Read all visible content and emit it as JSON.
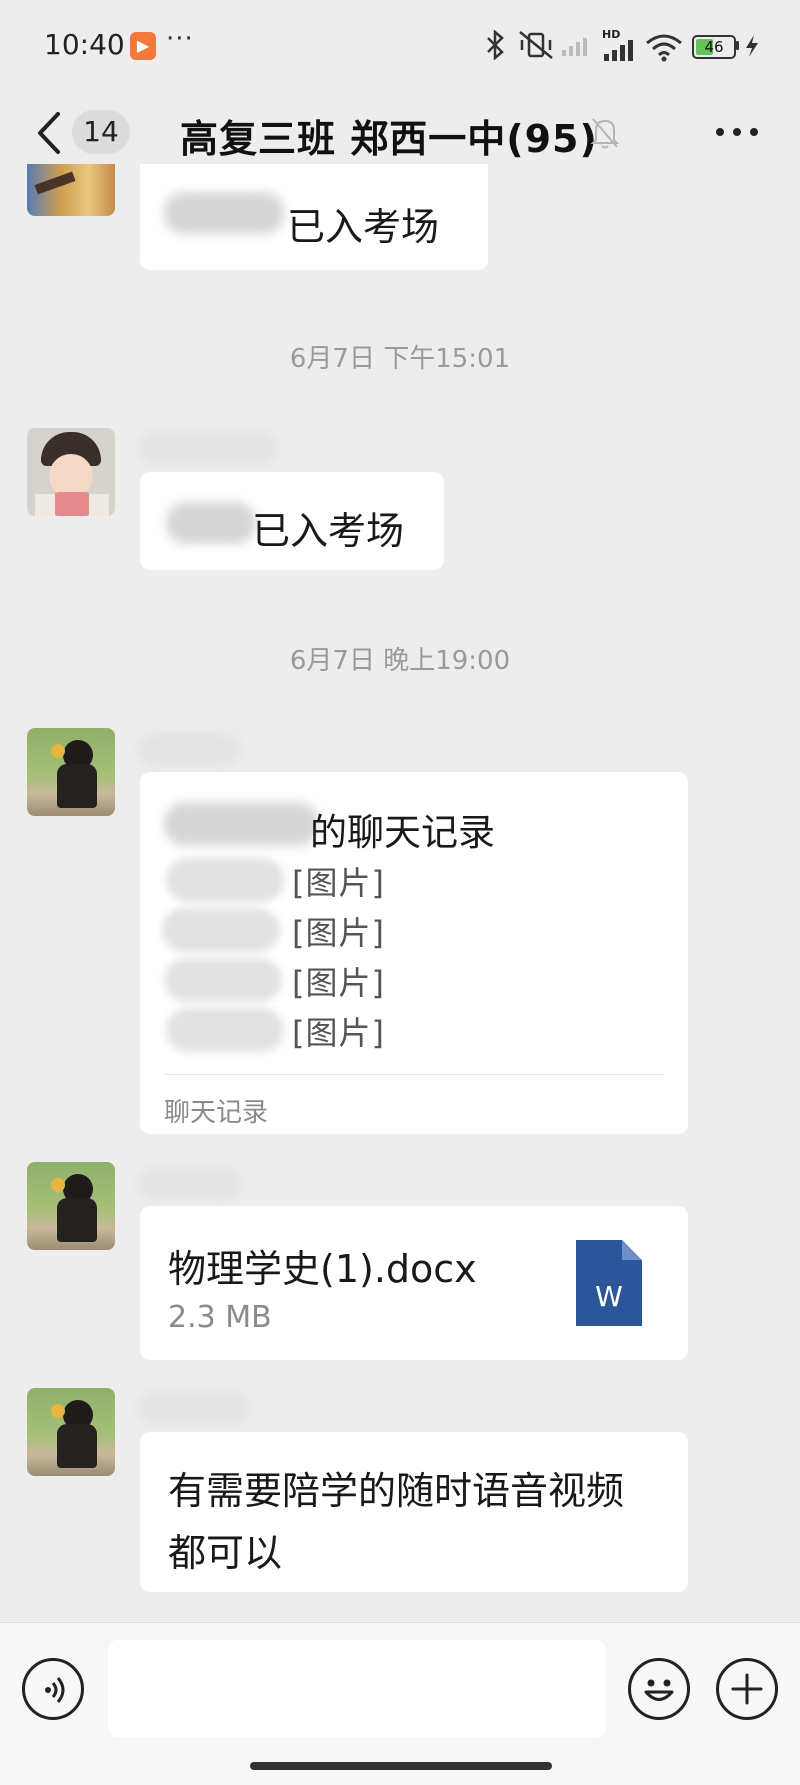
{
  "status_bar": {
    "time": "10:40",
    "more": "···",
    "network": "HD",
    "battery": "46",
    "battery_level": 0.46,
    "app_icon_name": "video-app-icon"
  },
  "header": {
    "unread_count": "14",
    "title": "高复三班 郑西一中(95)"
  },
  "messages": [
    {
      "text_suffix": "已入考场"
    },
    {
      "timestamp": "6月7日 下午15:01",
      "text_suffix": "已入考场"
    },
    {
      "timestamp": "6月7日 晚上19:00",
      "record_title_suffix": "的聊天记录",
      "record_lines": [
        "[图片]",
        "[图片]",
        "[图片]",
        "[图片]"
      ],
      "record_footer": "聊天记录"
    },
    {
      "file_name": "物理学史(1).docx",
      "file_size": "2.3 MB",
      "file_icon_letter": "W"
    },
    {
      "text_line1": "有需要陪学的随时语音视频",
      "text_line2": "都可以"
    }
  ],
  "colors": {
    "background": "#ededed",
    "bubble": "#ffffff",
    "word_icon": "#2b579a",
    "battery": "#63c35a"
  }
}
